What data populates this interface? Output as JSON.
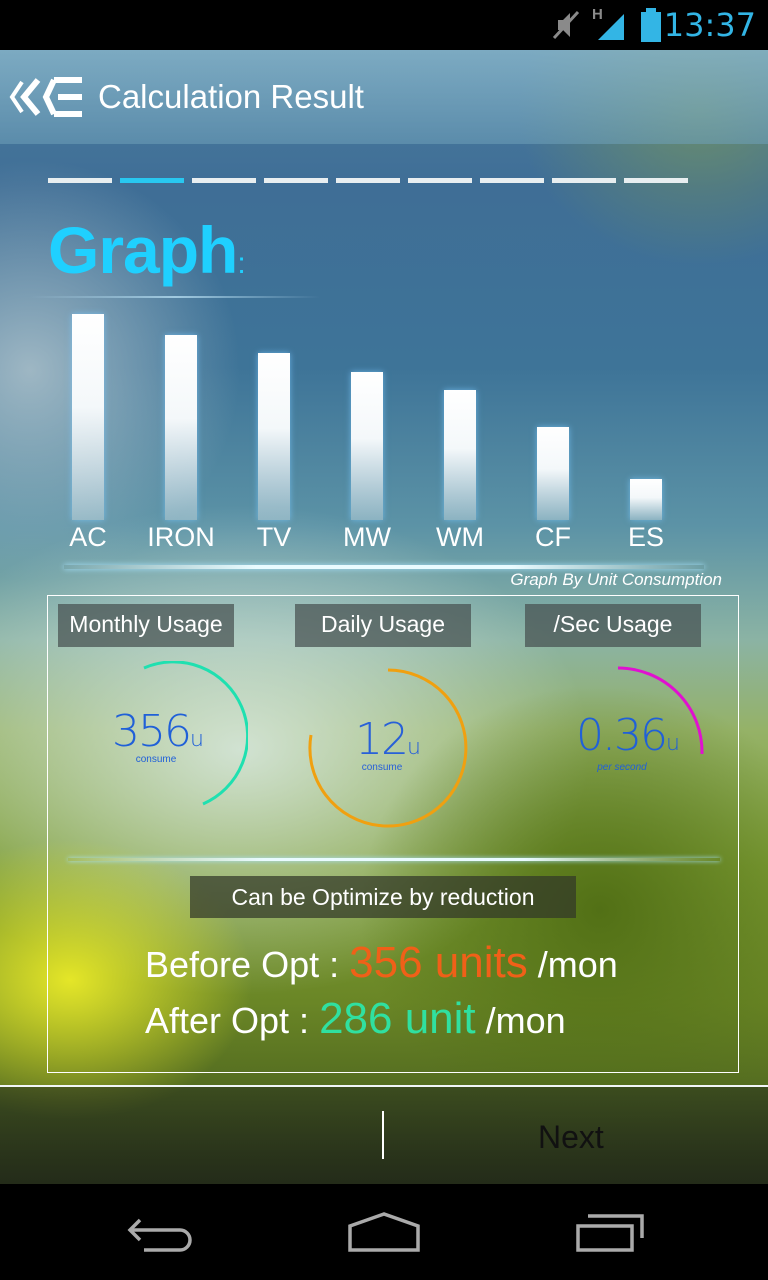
{
  "status_bar": {
    "time": "13:37",
    "network": "H"
  },
  "header": {
    "title": "Calculation Result"
  },
  "steps": {
    "count": 9,
    "active_index": 1
  },
  "graph": {
    "heading": "Graph",
    "heading_suffix": ":",
    "caption": "Graph By Unit Consumption"
  },
  "chart_data": {
    "type": "bar",
    "title": "Graph",
    "caption": "Graph By Unit Consumption",
    "categories": [
      "AC",
      "IRON",
      "TV",
      "MW",
      "WM",
      "CF",
      "ES"
    ],
    "values": [
      100,
      90,
      81,
      72,
      63,
      45,
      20
    ],
    "ylim": [
      0,
      100
    ],
    "grid": false
  },
  "usage": {
    "monthly": {
      "label": "Monthly Usage",
      "value": "356",
      "unit": "u",
      "sub": "consume",
      "color": "#1fe0b0",
      "value_color": "#2060d8",
      "fraction": 0.36
    },
    "daily": {
      "label": "Daily Usage",
      "value": "12",
      "unit": "u",
      "sub": "consume",
      "color": "#f0a010",
      "value_color": "#2860d8",
      "fraction": 0.62
    },
    "per_sec": {
      "label": "/Sec Usage",
      "value": "0.36",
      "unit": "u",
      "sub": "per second",
      "color": "#e010d0",
      "value_color": "#2060d8",
      "fraction": 0.14
    }
  },
  "optimization": {
    "label": "Can be Optimize  by reduction",
    "before_label": "Before Opt :",
    "before_value": "356 units",
    "before_unit": "/mon",
    "before_color": "#f06018",
    "after_label": "After Opt :",
    "after_value": "286 unit",
    "after_unit": "/mon",
    "after_color": "#30e0a0"
  },
  "footer": {
    "next_label": "Next"
  }
}
